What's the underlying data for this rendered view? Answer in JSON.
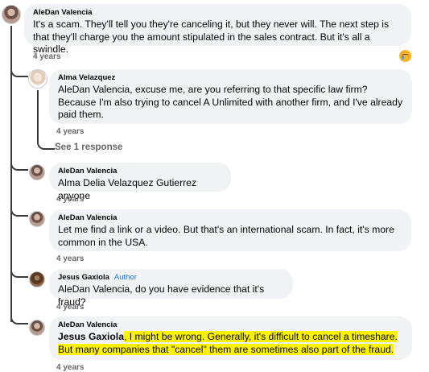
{
  "comments": [
    {
      "author": "AleDan Valencia",
      "text": "It's a scam. They'll tell you they're canceling it, but they never will. The next step is that they'll charge you the amount stipulated in the sales contract. But it's all a swindle.",
      "time": "4 years",
      "reaction_icon": "crying-face-icon"
    },
    {
      "author": "Alma Velazquez",
      "text": "AleDan Valencia, excuse me, are you referring to that specific law firm? Because I'm also trying to cancel A Unlimited with another firm, and I've already paid them.",
      "time": "4 years",
      "replies_link": "See 1 response"
    },
    {
      "author": "AleDan Valencia",
      "text": "Alma Delia Velazquez Gutierrez anyone",
      "time": "4 years"
    },
    {
      "author": "AleDan Valencia",
      "text": "Let me find a link or a video. But that's an international scam. In fact, it's more common in the USA.",
      "time": "4 years"
    },
    {
      "author": "Jesus Gaxiola",
      "badge": "Author",
      "text": "AleDan Valencia, do you have evidence that it's fraud?",
      "time": "4 years"
    },
    {
      "author": "AleDan Valencia",
      "mention": "Jesus Gaxiola",
      "text_after_mention": ", I might be wrong. Generally, it's difficult to cancel a timeshare. But many companies that \"cancel\" them are sometimes also part of the fraud.",
      "time": "4 years"
    }
  ],
  "colors": {
    "bubble": "#f0f2f5",
    "timestamp": "#65676b",
    "author_badge": "#1b74e4",
    "highlight": "#fff200"
  }
}
